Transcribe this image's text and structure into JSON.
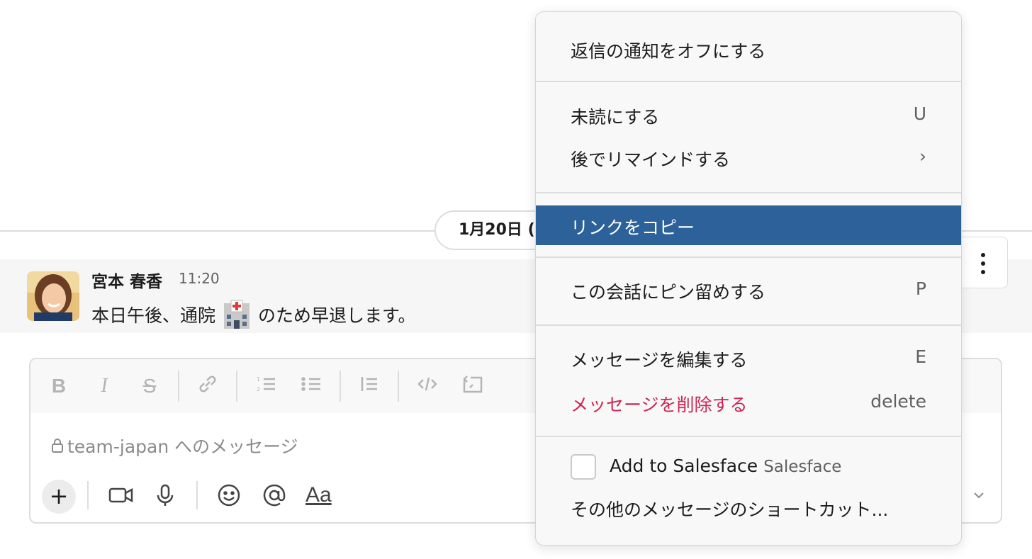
{
  "date_divider": {
    "label": "1月20日 ("
  },
  "message": {
    "author": "宮本 春香",
    "time": "11:20",
    "text_before": "本日午後、通院",
    "emoji": "hospital-icon",
    "text_after": "のため早退します。"
  },
  "composer": {
    "placeholder": "team-japan へのメッセージ",
    "format_label": "Aa",
    "toolbar_icons": [
      "bold-icon",
      "italic-icon",
      "strikethrough-icon",
      "link-icon",
      "ordered-list-icon",
      "bullet-list-icon",
      "blockquote-icon",
      "code-icon",
      "code-block-icon"
    ],
    "bottom_icons": [
      "plus-icon",
      "video-icon",
      "microphone-icon",
      "emoji-icon",
      "mention-icon",
      "formatting-icon",
      "chevron-down-icon"
    ]
  },
  "context_menu": {
    "turn_off_notifications": "返信の通知をオフにする",
    "mark_unread": {
      "label": "未読にする",
      "shortcut": "U"
    },
    "remind_later": {
      "label": "後でリマインドする",
      "arrow": "›"
    },
    "copy_link": "リンクをコピー",
    "pin": {
      "label": "この会話にピン留めする",
      "shortcut": "P"
    },
    "edit": {
      "label": "メッセージを編集する",
      "shortcut": "E"
    },
    "delete": {
      "label": "メッセージを削除する",
      "shortcut": "delete"
    },
    "salesface": {
      "label": "Add to Salesface",
      "app": "Salesface"
    },
    "more_shortcuts": "その他のメッセージのショートカット..."
  },
  "colors": {
    "highlight": "#2c6199",
    "danger": "#cd2553",
    "menu_bg": "#f8f8f8"
  }
}
